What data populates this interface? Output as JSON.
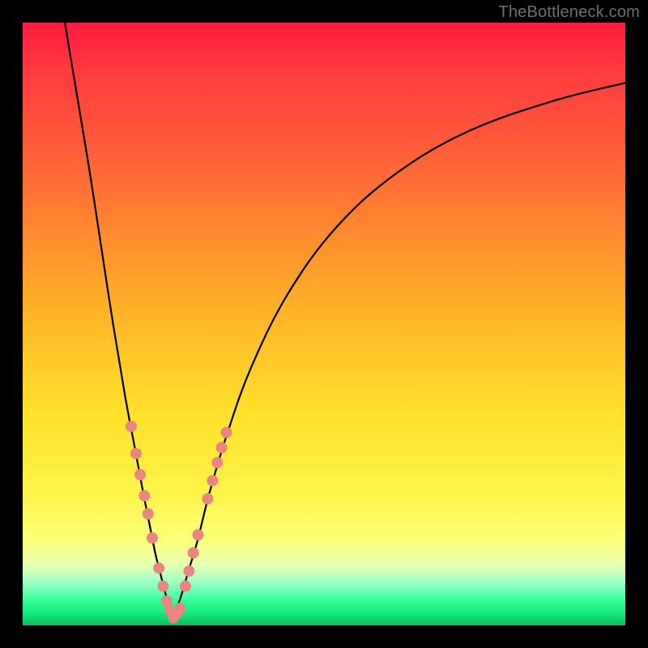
{
  "watermark": "TheBottleneck.com",
  "colors": {
    "background": "#000000",
    "curve": "#000000",
    "marker": "#e8867f"
  },
  "chart_data": {
    "type": "line",
    "title": "",
    "xlabel": "",
    "ylabel": "",
    "xlim": [
      0,
      100
    ],
    "ylim": [
      0,
      100
    ],
    "series": [
      {
        "name": "left-branch",
        "x": [
          7,
          9,
          11,
          13,
          15,
          17,
          18.5,
          20,
          21,
          22,
          23,
          24,
          24.6
        ],
        "y": [
          100,
          88,
          76,
          63,
          50,
          38,
          30,
          22,
          17,
          12,
          8,
          4,
          1
        ]
      },
      {
        "name": "right-branch",
        "x": [
          24.6,
          26,
          27.5,
          29,
          31,
          34,
          38,
          44,
          52,
          62,
          74,
          88,
          100
        ],
        "y": [
          1,
          4,
          9,
          14,
          22,
          32,
          43,
          55,
          66,
          75,
          82,
          87,
          90
        ]
      }
    ],
    "markers": [
      {
        "x": 18.0,
        "y": 33
      },
      {
        "x": 18.8,
        "y": 28.5
      },
      {
        "x": 19.5,
        "y": 25
      },
      {
        "x": 20.2,
        "y": 21.5
      },
      {
        "x": 20.8,
        "y": 18.5
      },
      {
        "x": 21.5,
        "y": 14.5
      },
      {
        "x": 22.6,
        "y": 9.5
      },
      {
        "x": 23.3,
        "y": 6.5
      },
      {
        "x": 23.9,
        "y": 4
      },
      {
        "x": 24.4,
        "y": 2.5
      },
      {
        "x": 25.0,
        "y": 1.3
      },
      {
        "x": 25.6,
        "y": 2
      },
      {
        "x": 26.1,
        "y": 2.8
      },
      {
        "x": 27.0,
        "y": 6.5
      },
      {
        "x": 27.6,
        "y": 9
      },
      {
        "x": 28.3,
        "y": 12
      },
      {
        "x": 29.1,
        "y": 15
      },
      {
        "x": 30.7,
        "y": 21
      },
      {
        "x": 31.5,
        "y": 24
      },
      {
        "x": 32.3,
        "y": 27
      },
      {
        "x": 33.0,
        "y": 29.5
      },
      {
        "x": 33.8,
        "y": 32
      }
    ],
    "marker_radius": 7
  }
}
